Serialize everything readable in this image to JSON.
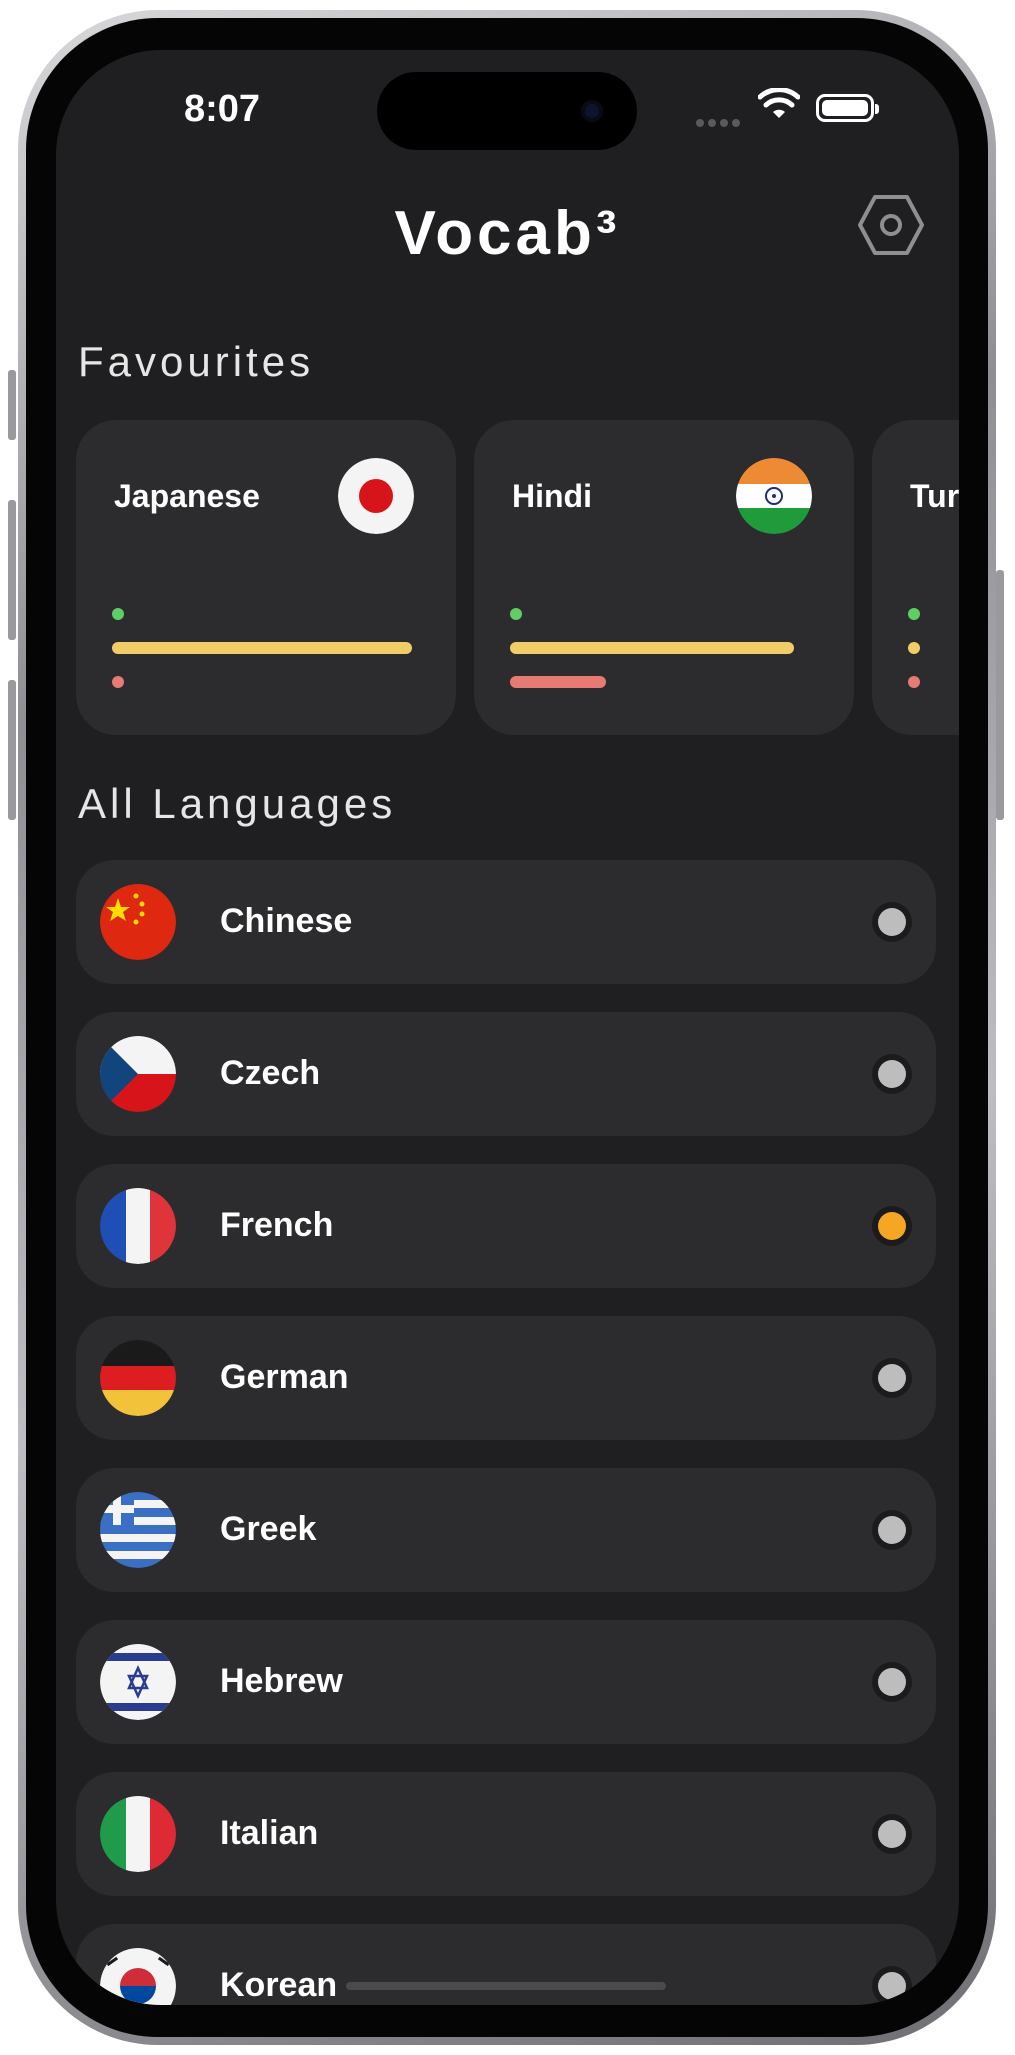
{
  "status_bar": {
    "time": "8:07",
    "icons": [
      "cellular-dots-icon",
      "wifi-icon",
      "battery-icon"
    ]
  },
  "header": {
    "title": "Vocab³",
    "settings_icon": "hexagon-gear-icon"
  },
  "favourites": {
    "title": "Favourites",
    "items": [
      {
        "name": "Japanese",
        "flag": "japan-flag-icon",
        "progress": [
          {
            "color": "#5fce67",
            "fraction": 0
          },
          {
            "color": "#f1cd6a",
            "fraction": 1.0
          },
          {
            "color": "#e77b73",
            "fraction": 0
          }
        ]
      },
      {
        "name": "Hindi",
        "flag": "india-flag-icon",
        "progress": [
          {
            "color": "#5fce67",
            "fraction": 0
          },
          {
            "color": "#f1cd6a",
            "fraction": 0.95
          },
          {
            "color": "#e77b73",
            "fraction": 0.32
          }
        ]
      },
      {
        "name": "Tur",
        "flag": "turkey-flag-icon",
        "progress": [
          {
            "color": "#5fce67",
            "fraction": 0
          },
          {
            "color": "#f1cd6a",
            "fraction": 0
          },
          {
            "color": "#e77b73",
            "fraction": 0
          }
        ]
      }
    ]
  },
  "all_languages": {
    "title": "All Languages",
    "items": [
      {
        "name": "Chinese",
        "flag": "china-flag-icon",
        "status_color": "#bdbdbd"
      },
      {
        "name": "Czech",
        "flag": "czech-flag-icon",
        "status_color": "#bdbdbd"
      },
      {
        "name": "French",
        "flag": "france-flag-icon",
        "status_color": "#f5a623"
      },
      {
        "name": "German",
        "flag": "germany-flag-icon",
        "status_color": "#bdbdbd"
      },
      {
        "name": "Greek",
        "flag": "greece-flag-icon",
        "status_color": "#bdbdbd"
      },
      {
        "name": "Hebrew",
        "flag": "israel-flag-icon",
        "status_color": "#bdbdbd"
      },
      {
        "name": "Italian",
        "flag": "italy-flag-icon",
        "status_color": "#bdbdbd"
      },
      {
        "name": "Korean",
        "flag": "korea-flag-icon",
        "status_color": "#bdbdbd"
      }
    ]
  },
  "colors": {
    "background": "#1f1f21",
    "card": "#2c2c2e",
    "text": "#ffffff"
  }
}
